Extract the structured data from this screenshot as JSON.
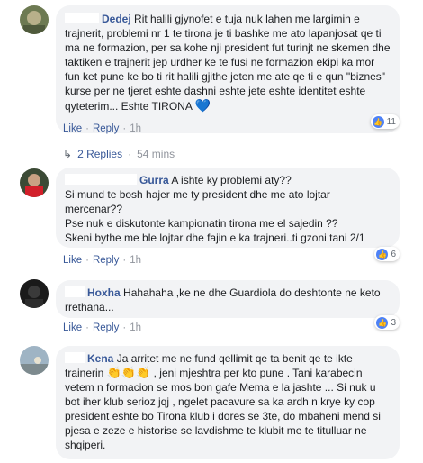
{
  "comments": [
    {
      "name": "Dedej",
      "text": "Rit halili gjynofet e tuja nuk lahen me largimin e trajnerit, problemi nr 1 te tirona je ti bashke me ato lapanjosat qe ti ma ne formazion, per sa kohe nji president fut turinjt ne skemen dhe taktiken e trajnerit jep urdher ke te fusi ne formazion ekipi ka mor fun ket pune ke bo ti rit halili gjithe jeten me ate qe ti e qun \"biznes\" kurse per ne tjeret eshte dashni eshte jete eshte identitet eshte qyteterim... Eshte TIRONA",
      "heart": "💙",
      "reaction_count": "11",
      "like": "Like",
      "reply": "Reply",
      "time": "1h",
      "replies_label": "2 Replies",
      "replies_time": "54 mins"
    },
    {
      "name": "Gurra",
      "text_lines": [
        "A ishte ky problemi aty??",
        "Si mund te bosh hajer me ty president dhe me ato lojtar mercenar??",
        "Pse nuk e diskutonte kampionatin tirona me el sajedin ??",
        "Skeni bythe me ble lojtar dhe fajin e ka trajneri..ti gzoni tani 2/1"
      ],
      "reaction_count": "6",
      "like": "Like",
      "reply": "Reply",
      "time": "1h"
    },
    {
      "name": "Hoxha",
      "text": "Hahahaha ,ke ne dhe Guardiola do deshtonte ne keto rrethana...",
      "reaction_count": "3",
      "like": "Like",
      "reply": "Reply",
      "time": "1h"
    },
    {
      "name": "Kena",
      "text_a": "Ja arritet me ne fund qellimit qe ta benit qe te ikte trainerin",
      "emojis": "👏👏👏",
      "text_b": ", jeni mjeshtra per kto pune . Tani karabecin vetem n formacion se mos bon gafe Mema e la jashte ... Si nuk u bot iher klub serioz jqj , ngelet pacavure sa ka ardh n krye ky cop president eshte bo Tirona klub i dores se 3te, do mbaheni mend si pjesa e zeze e historise se lavdishme te klubit me te titulluar ne shqiperi."
    }
  ],
  "colors": {
    "name": "#385898",
    "bubble": "#f2f3f5",
    "like_blue": "#4e82f6"
  },
  "icons": {
    "like": "like-icon",
    "reply_arrow": "reply-arrow-icon"
  }
}
